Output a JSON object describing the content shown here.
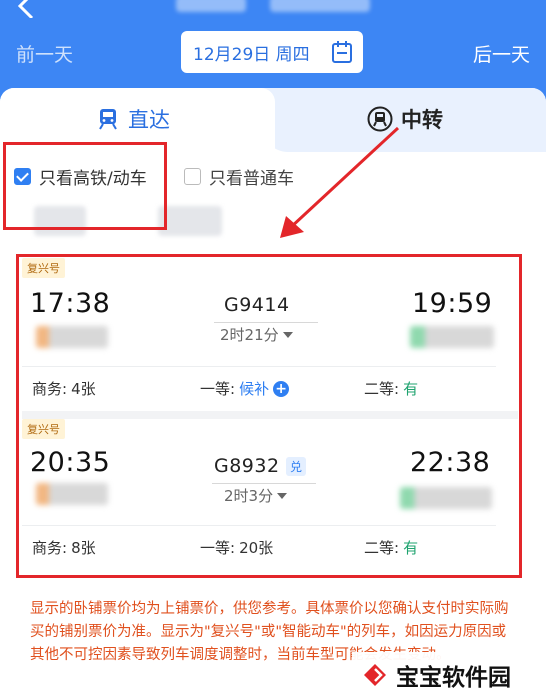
{
  "header": {
    "prev_day": "前一天",
    "next_day": "后一天",
    "date": "12月29日 周四"
  },
  "tabs": {
    "direct": "直达",
    "transfer": "中转"
  },
  "filters": {
    "high_speed": "只看高铁/动车",
    "high_speed_checked": true,
    "normal": "只看普通车",
    "normal_checked": false
  },
  "trains": [
    {
      "badge": "复兴号",
      "depart_time": "17:38",
      "train_no": "G9414",
      "duration": "2时21分",
      "arrive_time": "19:59",
      "seats": [
        {
          "label": "商务: ",
          "value": "4张"
        },
        {
          "label": "一等: ",
          "value": "候补"
        },
        {
          "label": "二等: ",
          "value": "有"
        }
      ]
    },
    {
      "badge": "复兴号",
      "depart_time": "20:35",
      "train_no": "G8932",
      "exchange_badge": "兑",
      "duration": "2时3分",
      "arrive_time": "22:38",
      "seats": [
        {
          "label": "商务: ",
          "value": "8张"
        },
        {
          "label": "一等: ",
          "value": "20张"
        },
        {
          "label": "二等: ",
          "value": "有"
        }
      ]
    }
  ],
  "notice": "显示的卧铺票价均为上铺票价，供您参考。具体票价以您确认支付时实际购买的铺别票价为准。显示为\"复兴号\"或\"智能动车\"的列车，如因运力原因或其他不可控因素导致列车调度调整时，当前车型可能会发生变动。",
  "watermark": "宝宝软件园",
  "colors": {
    "header_blue": "#3d86f4",
    "accent_blue": "#2f7ff2",
    "annotation_red": "#e3262a",
    "available_green": "#1fa36f",
    "notice_orange": "#e0501e"
  }
}
